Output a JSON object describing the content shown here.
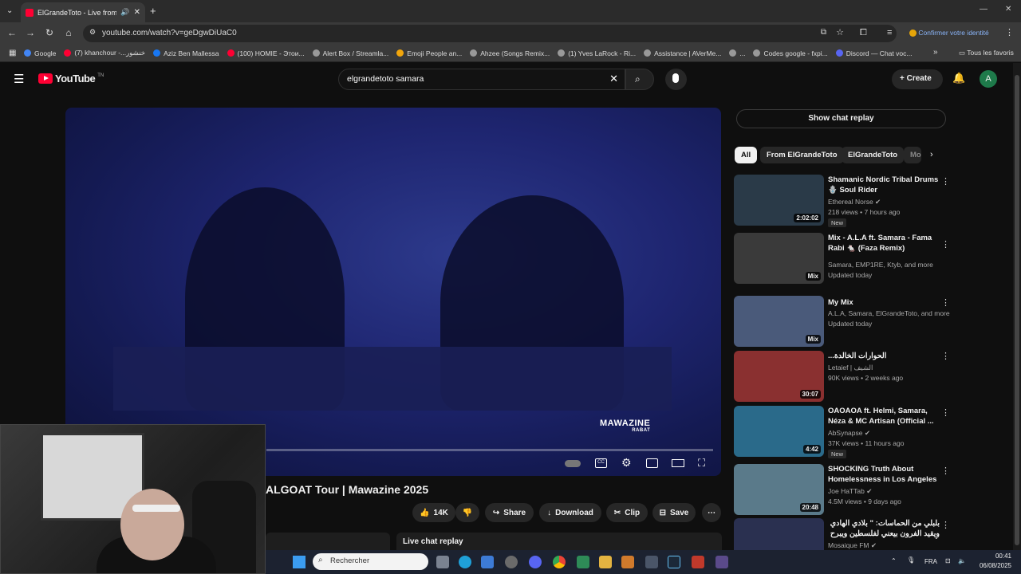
{
  "browser": {
    "tab_title": "ElGrandeToto - Live from C",
    "url": "youtube.com/watch?v=geDgwDiUaC0",
    "profile_label": "Confirmer votre identité",
    "bookmarks": [
      "Google",
      "(7) khanchour -...خنشور",
      "Aziz Ben Mallessa",
      "(100) HOMIE - Этои...",
      "Alert Box / Streamla...",
      "Emoji People an...",
      "Ahzee (Songs Remix...",
      "(1) Yves LaRock - Ri...",
      "Assistance | AVerMe...",
      "...",
      "Codes google - fxpi...",
      "Discord — Chat voc..."
    ],
    "all_favorites": "Tous les favoris"
  },
  "youtube": {
    "logo_text": "YouTube",
    "logo_region": "TN",
    "search_value": "elgrandetoto samara",
    "create_label": "Create",
    "avatar_letter": "A"
  },
  "video": {
    "title": "ALGOAT Tour | Mawazine 2025",
    "watermark": "MAWAZINE",
    "watermark_sub": "RABAT",
    "actions": {
      "likes": "14K",
      "share": "Share",
      "download": "Download",
      "clip": "Clip",
      "save": "Save"
    },
    "live_chat_replay": "Live chat replay"
  },
  "sidebar": {
    "show_chat_replay": "Show chat replay",
    "chips": [
      "All",
      "From ElGrandeToto",
      "ElGrandeToto",
      "Mo"
    ],
    "recommendations": [
      {
        "title": "Shamanic Nordic Tribal Drums 🪬 Soul Rider",
        "channel": "Ethereal Norse ✔",
        "meta": "218 views • 7 hours ago",
        "badge": "New",
        "duration": "2:02:02",
        "thumb_color": "#2a3a48"
      },
      {
        "title": "Mix - A.L.A ft. Samara - Fama Rabi 🐁 (Faza Remix)",
        "channel": "Samara, EMP1RE, Ktyb, and more",
        "meta": "Updated today",
        "badge": "",
        "duration": "Mix",
        "thumb_color": "#3a3a3a"
      },
      {
        "title": "My Mix",
        "channel": "A.L.A, Samara, ElGrandeToto, and more",
        "meta": "Updated today",
        "badge": "",
        "duration": "Mix",
        "thumb_color": "#4a5a7a"
      },
      {
        "title": "...الحوارات الخالدة",
        "channel": "Letaief | الشيف",
        "meta": "90K views • 2 weeks ago",
        "badge": "",
        "duration": "30:07",
        "thumb_color": "#8a3030"
      },
      {
        "title": "OAOAOA ft. Helmi, Samara, Néza & MC Artisan (Official ...",
        "channel": "AbSynapse ✔",
        "meta": "37K views • 11 hours ago",
        "badge": "New",
        "duration": "4:42",
        "thumb_color": "#2a6a8a"
      },
      {
        "title": "SHOCKING Truth About Homelessness in Los Angeles ...",
        "channel": "Joe HaTTab ✔",
        "meta": "4.5M views • 9 days ago",
        "badge": "",
        "duration": "20:48",
        "thumb_color": "#5a7a8a"
      },
      {
        "title": "بلبلي من الحماسات: \" بلادي الهادي ويقيد الفرون بيعني لفلسطين ويبرح بأفكار الاعتزال",
        "channel": "Mosaique FM ✔",
        "meta": "",
        "badge": "",
        "duration": "",
        "thumb_color": "#2a3050"
      }
    ]
  },
  "taskbar": {
    "search_placeholder": "Rechercher",
    "language": "FRA",
    "time": "00:41",
    "date": "06/08/2025"
  }
}
